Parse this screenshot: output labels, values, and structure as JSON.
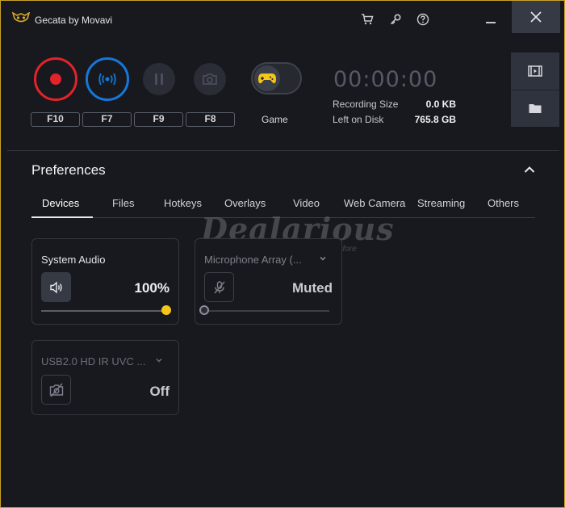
{
  "window": {
    "title": "Gecata by Movavi",
    "border_color": "#c9a227"
  },
  "titlebar_icons": [
    "cart-icon",
    "key-icon",
    "help-icon",
    "minimize-icon",
    "close-icon"
  ],
  "controls": {
    "hotkeys": [
      "F10",
      "F7",
      "F9",
      "F8"
    ],
    "game_label": "Game",
    "record_color": "#e3232a",
    "stream_color": "#1677d9",
    "game_mode_enabled": false
  },
  "status": {
    "timer": "00:00:00",
    "recording_size_label": "Recording Size",
    "recording_size_value": "0.0 KB",
    "left_on_disk_label": "Left on Disk",
    "left_on_disk_value": "765.8 GB"
  },
  "preferences": {
    "title": "Preferences",
    "tabs": [
      "Devices",
      "Files",
      "Hotkeys",
      "Overlays",
      "Video",
      "Web Camera",
      "Streaming",
      "Others"
    ],
    "active_tab": "Devices"
  },
  "devices": [
    {
      "name": "System Audio",
      "value": "100%",
      "level": 1.0,
      "accent": "#f5c518",
      "enabled": true
    },
    {
      "name": "Microphone Array (...",
      "value": "Muted",
      "level": 0.0,
      "enabled": false
    },
    {
      "name": "USB2.0 HD IR UVC ...",
      "value": "Off",
      "enabled": false
    }
  ],
  "watermark": {
    "text": "Dealarious",
    "subtext": "Software Deals Like Never Before"
  }
}
